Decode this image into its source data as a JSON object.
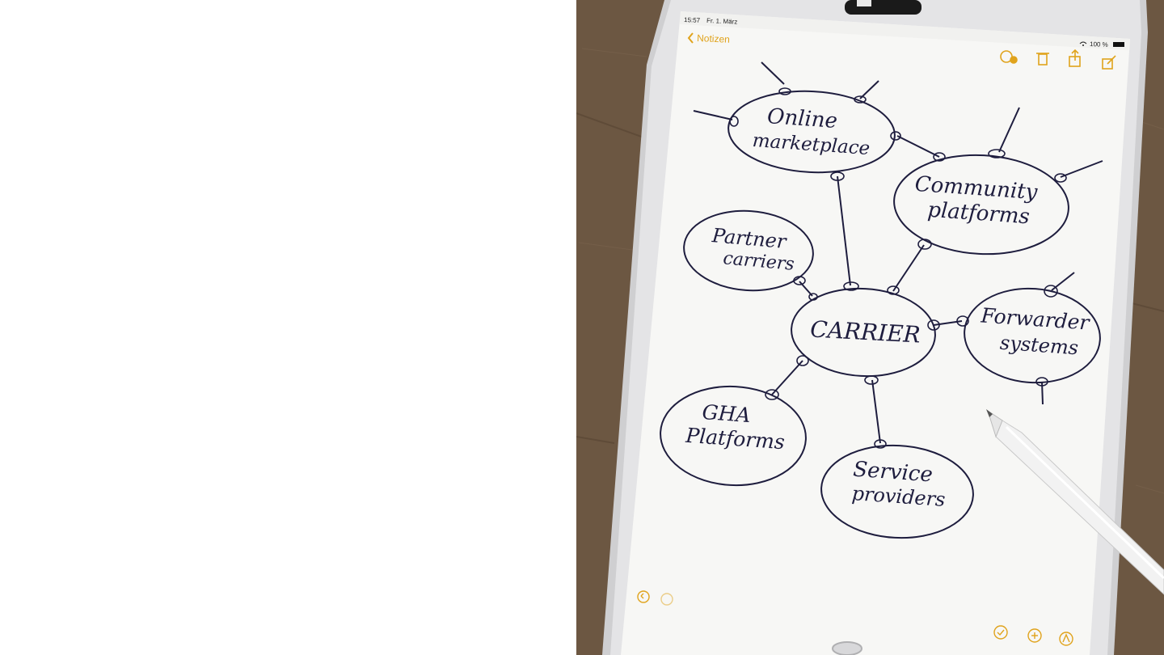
{
  "status_bar": {
    "time": "15:57",
    "date": "Fr. 1. März",
    "battery": "100 %"
  },
  "nav": {
    "back_label": "Notizen"
  },
  "toolbar_icons": [
    "collaborate-icon",
    "trash-icon",
    "share-icon",
    "compose-icon"
  ],
  "bottom_icons": [
    "undo-icon",
    "redo-icon",
    "checklist-icon",
    "add-icon",
    "markup-pen-icon"
  ],
  "sketch": {
    "center": "CARRIER",
    "nodes": [
      {
        "line1": "Online",
        "line2": "marketplace"
      },
      {
        "line1": "Community",
        "line2": "platforms"
      },
      {
        "line1": "Partner",
        "line2": "carriers"
      },
      {
        "line1": "Forwarder",
        "line2": "systems"
      },
      {
        "line1": "GHA",
        "line2": "Platforms"
      },
      {
        "line1": "Service",
        "line2": "providers"
      }
    ]
  },
  "colors": {
    "accent": "#e0a31c",
    "ink": "#1e1d3e",
    "paper": "#f7f7f5",
    "wood": "#6f5a44"
  }
}
